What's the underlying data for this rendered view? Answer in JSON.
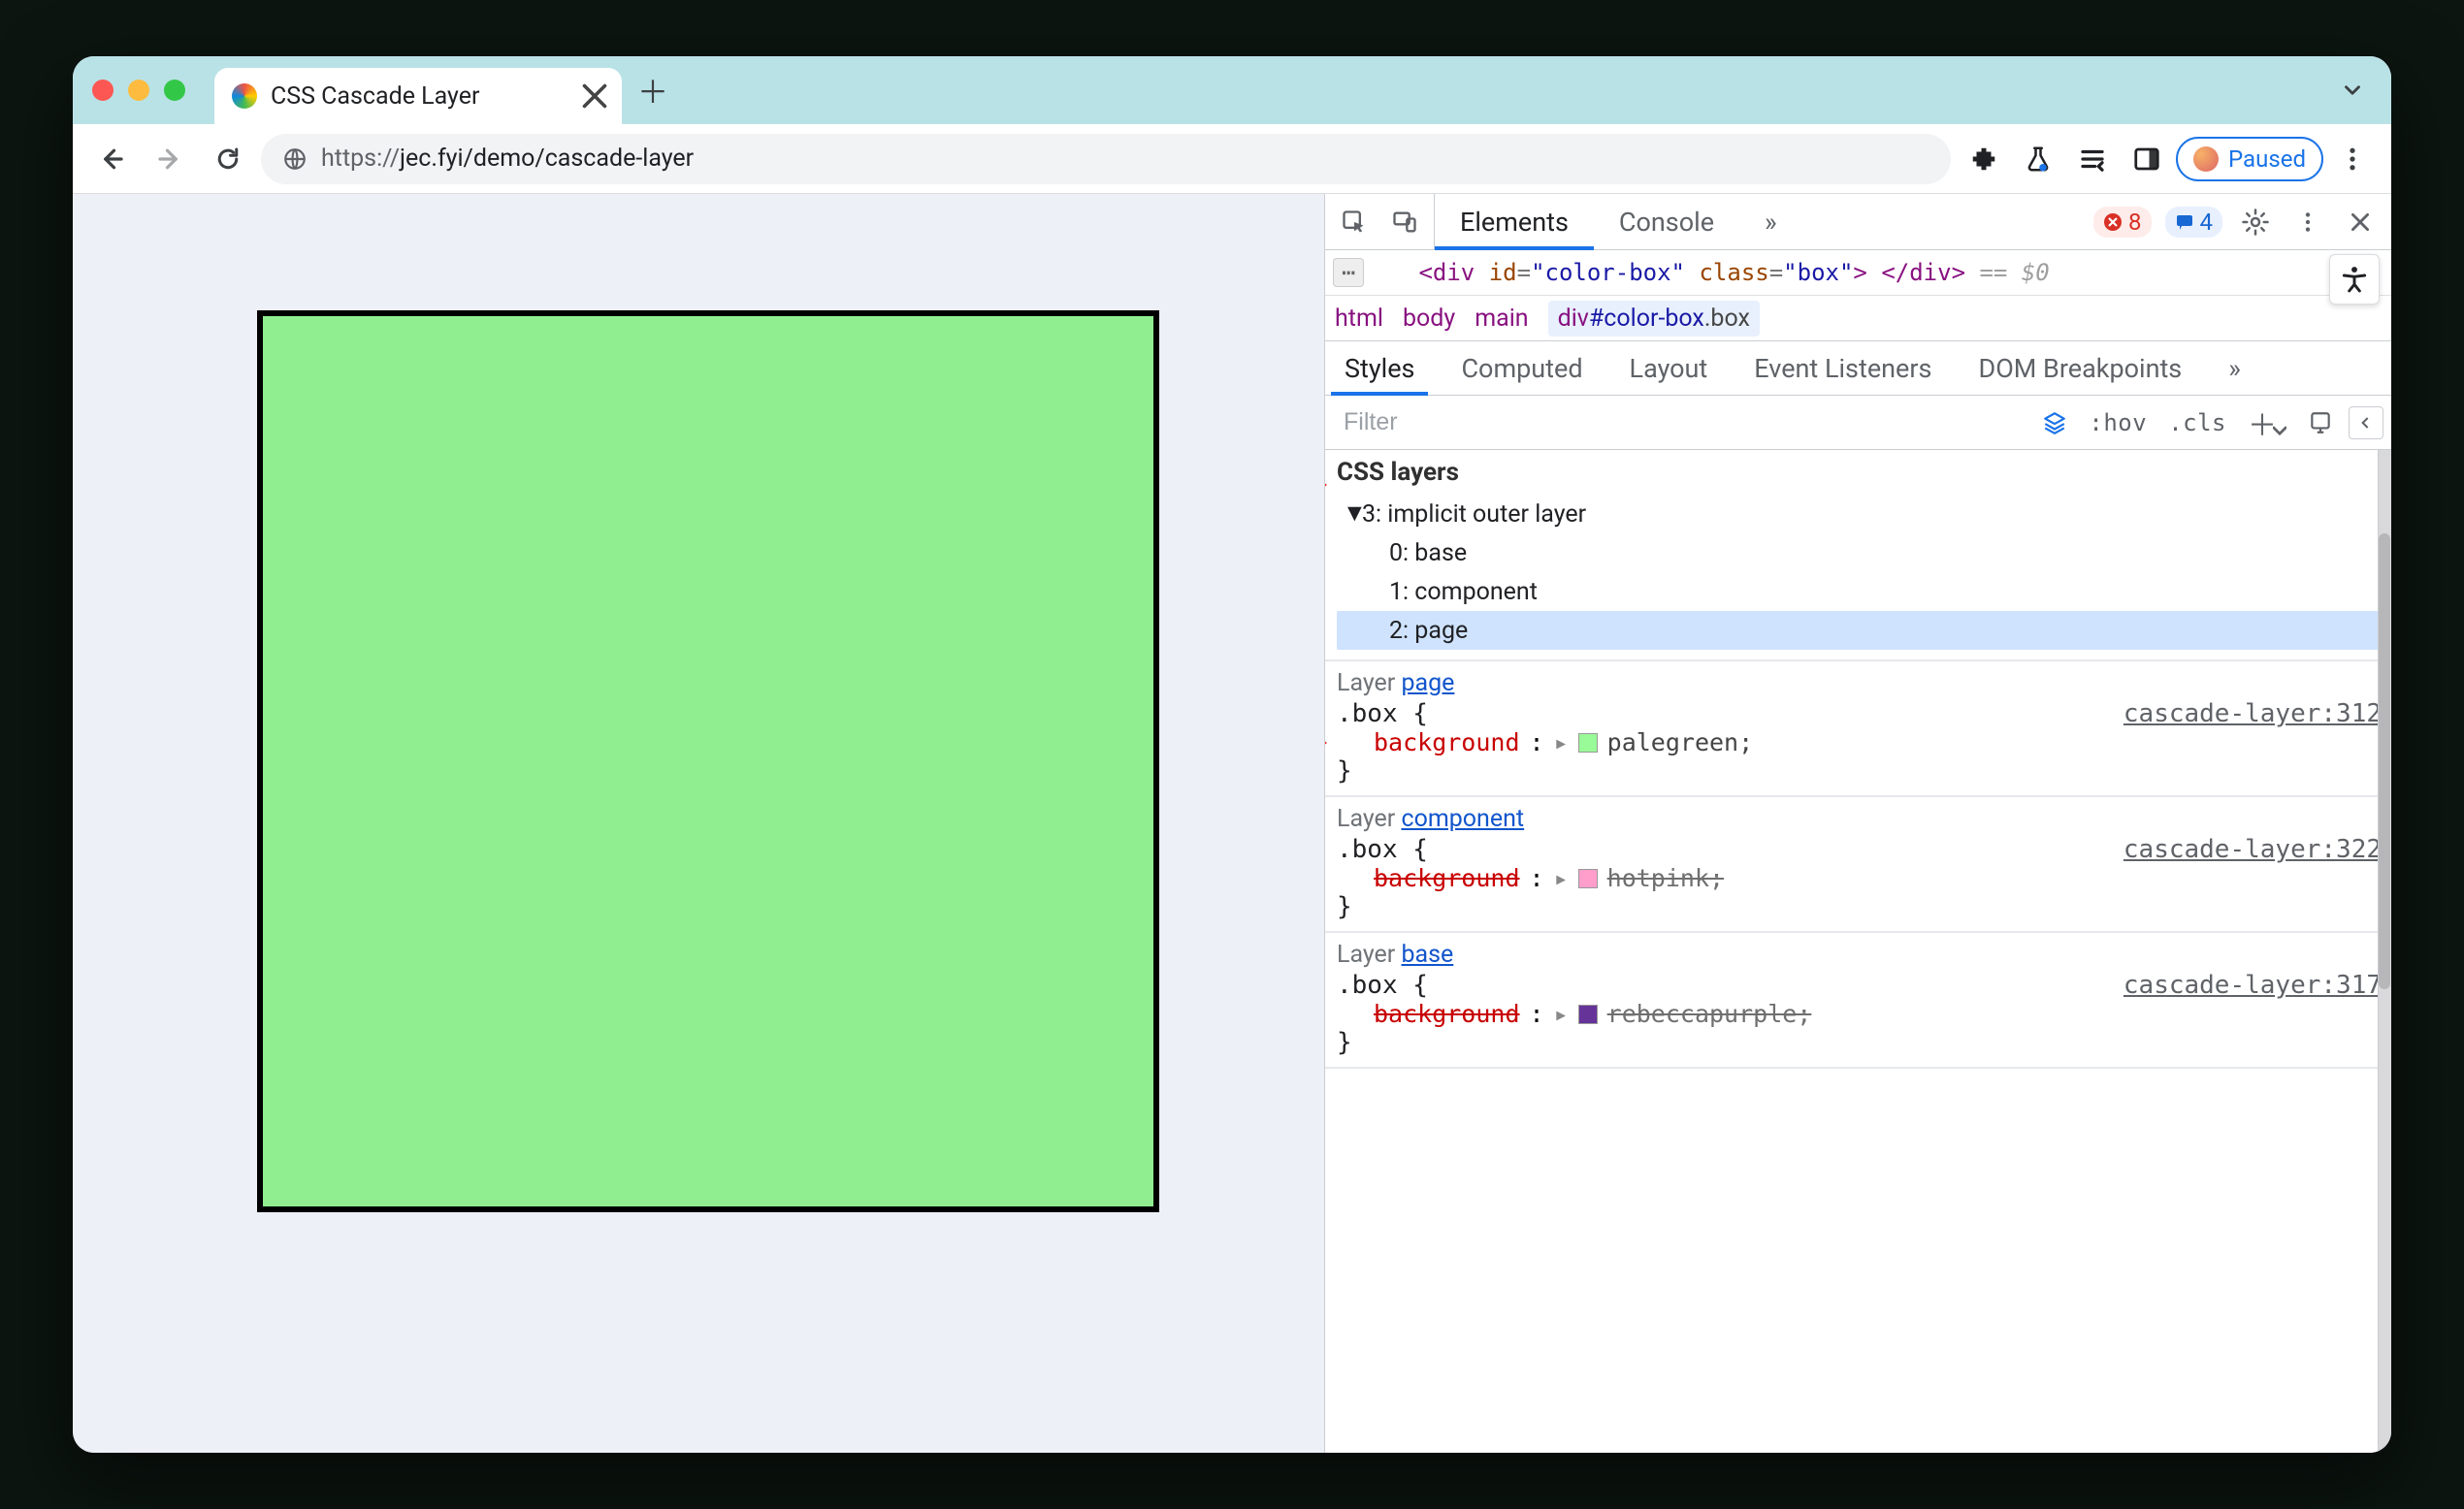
{
  "window": {
    "chevron_title": "More"
  },
  "tab": {
    "title": "CSS Cascade Layer"
  },
  "omnibox": {
    "scheme": "https://",
    "rest": "jec.fyi/demo/cascade-layer",
    "paused_label": "Paused"
  },
  "devtools": {
    "tabs": {
      "elements": "Elements",
      "console": "Console",
      "more": "»"
    },
    "counts": {
      "errors": "8",
      "messages": "4"
    },
    "dom_snippet": {
      "open": "<div",
      "id_attr": "id",
      "id_val": "\"color-box\"",
      "class_attr": "class",
      "class_val": "\"box\"",
      "close_open": ">",
      "close": "</div>",
      "marker": "== $0"
    },
    "crumbs": [
      "html",
      "body",
      "main",
      "div#color-box.box"
    ],
    "styles_tabs": {
      "styles": "Styles",
      "computed": "Computed",
      "layout": "Layout",
      "listeners": "Event Listeners",
      "dom_bp": "DOM Breakpoints",
      "more": "»"
    },
    "filter": {
      "placeholder": "Filter",
      "hov": ":hov",
      "cls": ".cls"
    },
    "css_layers": {
      "heading": "CSS layers",
      "root": "3: implicit outer layer",
      "children": [
        "0: base",
        "1: component",
        "2: page"
      ]
    },
    "rules": [
      {
        "layer_label": "Layer ",
        "layer_link": "page",
        "selector": ".box {",
        "source": "cascade-layer:312",
        "prop_name": "background",
        "prop_value": "palegreen",
        "swatch": "palegreen",
        "overridden": false,
        "close": "}"
      },
      {
        "layer_label": "Layer ",
        "layer_link": "component",
        "selector": ".box {",
        "source": "cascade-layer:322",
        "prop_name": "background",
        "prop_value": "hotpink",
        "swatch": "hotpink",
        "overridden": true,
        "close": "}"
      },
      {
        "layer_label": "Layer ",
        "layer_link": "base",
        "selector": ".box {",
        "source": "cascade-layer:317",
        "prop_name": "background",
        "prop_value": "rebeccapurple",
        "swatch": "rebeccapurple",
        "overridden": true,
        "close": "}"
      }
    ]
  }
}
